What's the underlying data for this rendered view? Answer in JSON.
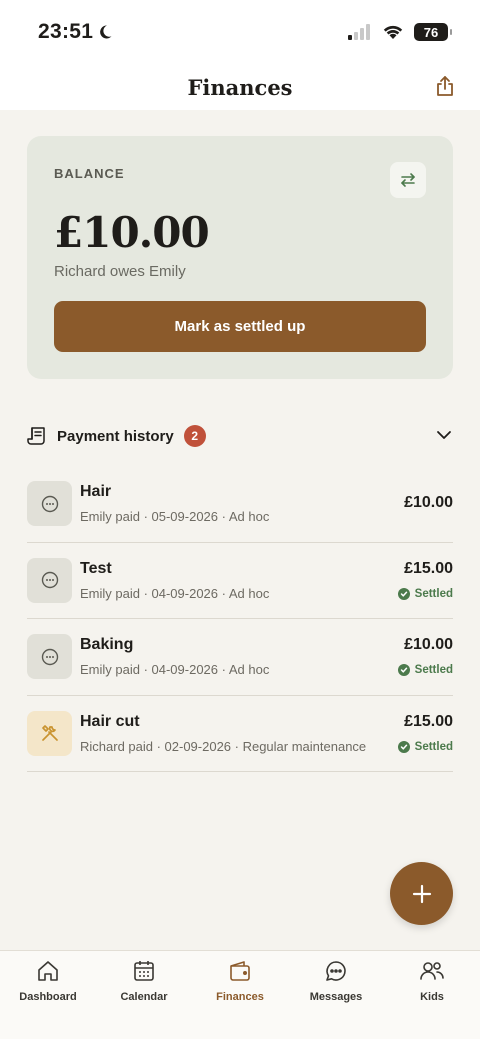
{
  "status_bar": {
    "time": "23:51",
    "battery": "76"
  },
  "header": {
    "title": "Finances"
  },
  "balance": {
    "label": "BALANCE",
    "amount": "£10.00",
    "description": "Richard owes Emily",
    "settle_label": "Mark as settled up"
  },
  "history": {
    "title": "Payment history",
    "count": "2",
    "items": [
      {
        "title": "Hair",
        "subtitle": "Emily paid · 05-09-2026 · Ad hoc",
        "amount": "£10.00",
        "status": ""
      },
      {
        "title": "Test",
        "subtitle": "Emily paid · 04-09-2026 · Ad hoc",
        "amount": "£15.00",
        "status": "Settled"
      },
      {
        "title": "Baking",
        "subtitle": "Emily paid · 04-09-2026 · Ad hoc",
        "amount": "£10.00",
        "status": "Settled"
      },
      {
        "title": "Hair cut",
        "subtitle": "Richard paid · 02-09-2026 · Regular maintenance",
        "amount": "£15.00",
        "status": "Settled"
      }
    ]
  },
  "tabs": [
    {
      "label": "Dashboard",
      "icon": "home-icon"
    },
    {
      "label": "Calendar",
      "icon": "calendar-icon"
    },
    {
      "label": "Finances",
      "icon": "wallet-icon",
      "active": true
    },
    {
      "label": "Messages",
      "icon": "chat-icon"
    },
    {
      "label": "Kids",
      "icon": "people-icon"
    }
  ],
  "colors": {
    "accent": "#8b5a2b",
    "badge": "#c0513a",
    "settled": "#4c7a4c",
    "card": "#e5e8df"
  }
}
